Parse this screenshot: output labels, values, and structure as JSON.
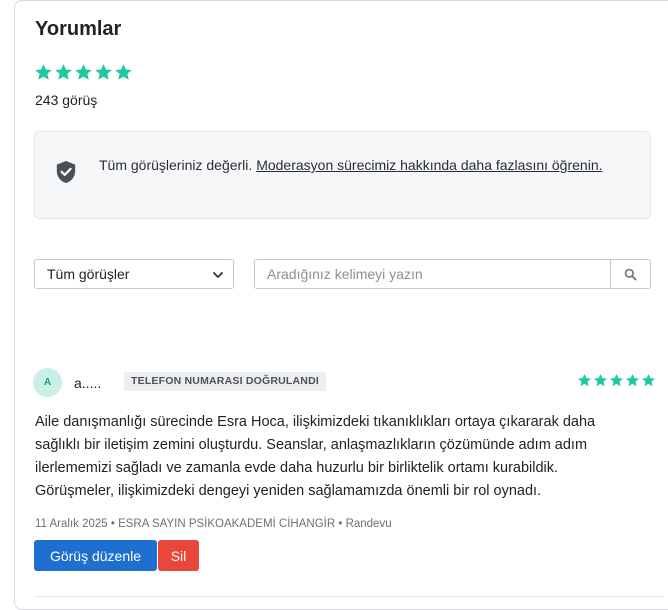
{
  "colors": {
    "star": "#1ec8a0",
    "primary": "#1f6fd1",
    "danger": "#e9473b"
  },
  "header": {
    "title": "Yorumlar",
    "rating_stars": 5,
    "count_text": "243 görüş"
  },
  "notice": {
    "icon": "shield-check-icon",
    "text": "Tüm görüşleriniz değerli.",
    "link_text": "Moderasyon sürecimiz hakkında daha fazlasını öğrenin."
  },
  "filter": {
    "selected": "Tüm görüşler",
    "icon": "chevron-down-icon"
  },
  "search": {
    "placeholder": "Aradığınız kelimeyi yazın",
    "icon": "search-icon"
  },
  "review": {
    "avatar_initial": "A",
    "name": "a.....",
    "badge": "TELEFON NUMARASI DOĞRULANDI",
    "stars": 5,
    "text": "Aile danışmanlığı sürecinde Esra Hoca, ilişkimizdeki tıkanıklıkları ortaya çıkararak daha sağlıklı bir iletişim zemini oluşturdu. Seanslar, anlaşmazlıkların çözümünde adım adım ilerlememizi sağladı ve zamanla evde daha huzurlu bir birliktelik ortamı kurabildik. Görüşmeler, ilişkimizdeki dengeyi yeniden sağlamamızda önemli bir rol oynadı.",
    "meta": "11 Aralık 2025 • ESRA SAYIN PSİKOAKADEMİ CİHANGİR • Randevu",
    "edit_label": "Görüş düzenle",
    "delete_label": "Sil"
  }
}
